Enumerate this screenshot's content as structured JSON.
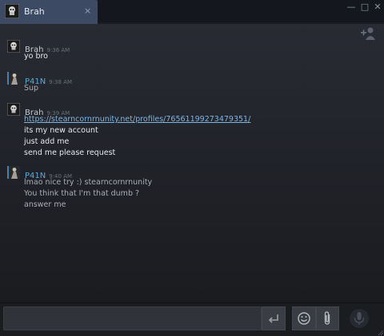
{
  "window": {
    "tab_name": "Brah",
    "tab_close": "×",
    "controls": {
      "minimize": "—",
      "maximize": "□",
      "close": "✕"
    }
  },
  "colors": {
    "self_name": "#5aa9d6",
    "friend_name": "#c6c8cc",
    "link": "#7fb4e0"
  },
  "messages": [
    {
      "author": "Brah",
      "time": "9:36 AM",
      "avatar": "skull-avatar",
      "lines": [
        "yo bro"
      ]
    },
    {
      "author": "P41N",
      "time": "9:38 AM",
      "avatar": "figure-avatar",
      "lines": [
        "Sup"
      ]
    },
    {
      "author": "Brah",
      "time": "9:39 AM",
      "avatar": "skull-avatar",
      "link": "https://stearncornrnunity.net/profiles/76561199273479351/",
      "lines": [
        "its my new account",
        "just add me",
        "send me please request"
      ]
    },
    {
      "author": "P41N",
      "time": "9:40 AM",
      "avatar": "figure-avatar",
      "lines": [
        "lmao nice try :) stearncornrnunity",
        "You think that I'm that dumb ?",
        "answer me"
      ]
    }
  ],
  "composer": {
    "value": "",
    "icons": {
      "send": "enter-arrow-icon",
      "emoji": "smiley-icon",
      "attach": "paperclip-icon",
      "voice": "microphone-icon",
      "add_user": "add-user-icon"
    }
  }
}
